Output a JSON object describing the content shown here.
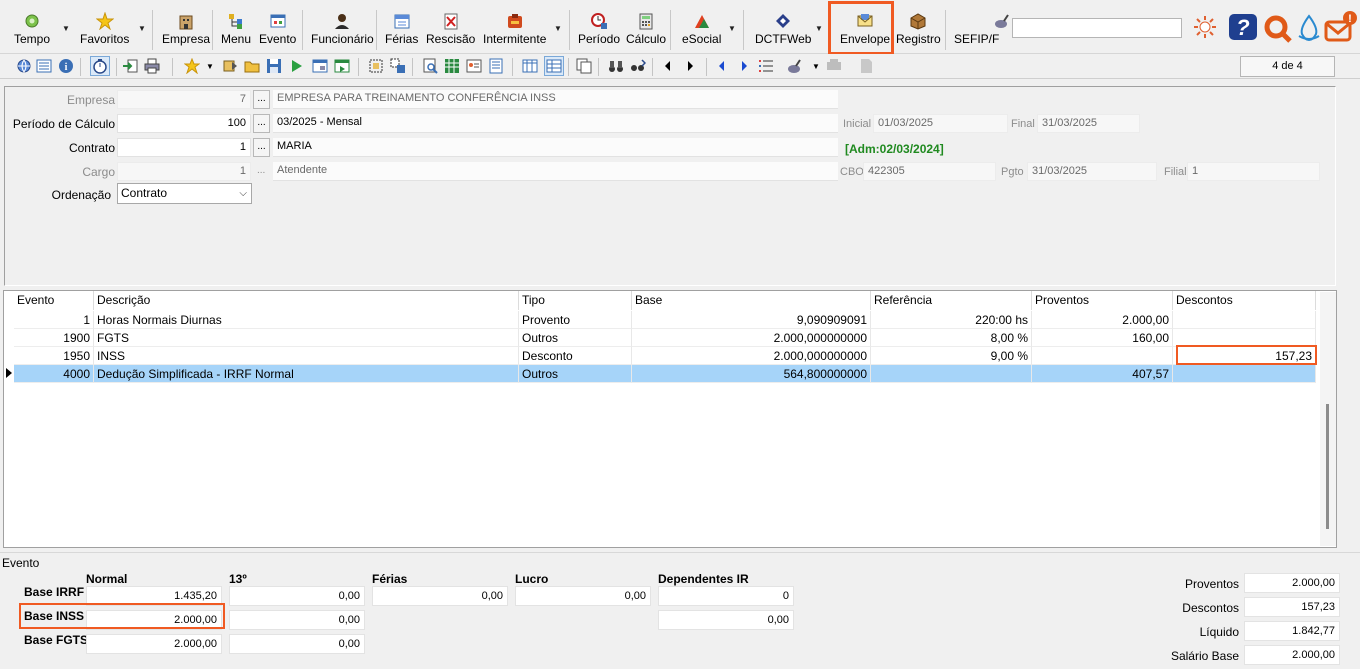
{
  "ribbon": {
    "tempo": "Tempo",
    "favoritos": "Favoritos",
    "empresa": "Empresa",
    "menu": "Menu",
    "evento": "Evento",
    "funcionario": "Funcionário",
    "ferias": "Férias",
    "rescisao": "Rescisão",
    "intermitente": "Intermitente",
    "periodo": "Período",
    "calculo": "Cálculo",
    "esocial": "eSocial",
    "dctfweb": "DCTFWeb",
    "envelope": "Envelope",
    "registro": "Registro",
    "sefip": "SEFIP/F",
    "sefip_value": ""
  },
  "toolbar2": {
    "record_counter": "4 de 4"
  },
  "form": {
    "empresa_label": "Empresa",
    "empresa_code": "7",
    "empresa_name": "EMPRESA PARA TREINAMENTO CONFERÊNCIA INSS",
    "periodo_label": "Período de Cálculo",
    "periodo_code": "100",
    "periodo_name": "03/2025 - Mensal",
    "inicial_label": "Inicial",
    "inicial_value": "01/03/2025",
    "final_label": "Final",
    "final_value": "31/03/2025",
    "contrato_label": "Contrato",
    "contrato_code": "1",
    "contrato_name": "MARIA",
    "admissao": "[Adm:02/03/2024]",
    "cargo_label": "Cargo",
    "cargo_code": "1",
    "cargo_name": "Atendente",
    "cbo_label": "CBO",
    "cbo_value": "422305",
    "pgto_label": "Pgto",
    "pgto_value": "31/03/2025",
    "filial_label": "Filial",
    "filial_value": "1",
    "ordenacao_label": "Ordenação",
    "ordenacao_value": "Contrato",
    "dots": "..."
  },
  "grid": {
    "columns": [
      "Evento",
      "Descrição",
      "Tipo",
      "Base",
      "Referência",
      "Proventos",
      "Descontos"
    ],
    "rows": [
      {
        "evento": "1",
        "descricao": "Horas Normais Diurnas",
        "tipo": "Provento",
        "base": "9,090909091",
        "referencia": "220:00 hs",
        "proventos": "2.000,00",
        "descontos": ""
      },
      {
        "evento": "1900",
        "descricao": "FGTS",
        "tipo": "Outros",
        "base": "2.000,000000000",
        "referencia": "8,00 %",
        "proventos": "160,00",
        "descontos": ""
      },
      {
        "evento": "1950",
        "descricao": "INSS",
        "tipo": "Desconto",
        "base": "2.000,000000000",
        "referencia": "9,00 %",
        "proventos": "",
        "descontos": "157,23"
      },
      {
        "evento": "4000",
        "descricao": "Dedução Simplificada - IRRF Normal",
        "tipo": "Outros",
        "base": "564,800000000",
        "referencia": "",
        "proventos": "407,57",
        "descontos": ""
      }
    ]
  },
  "bottom": {
    "section_title": "Evento",
    "col_normal": "Normal",
    "col_13": "13º",
    "col_ferias": "Férias",
    "col_lucro": "Lucro",
    "col_dependentes": "Dependentes IR",
    "base_irrf_label": "Base IRRF",
    "base_inss_label": "Base INSS",
    "base_fgts_label": "Base FGTS",
    "irrf_normal": "1.435,20",
    "irrf_13": "0,00",
    "irrf_ferias": "0,00",
    "irrf_lucro": "0,00",
    "irrf_dependentes": "0",
    "inss_normal": "2.000,00",
    "inss_13": "0,00",
    "inss_dependentes": "0,00",
    "fgts_normal": "2.000,00",
    "fgts_13": "0,00",
    "proventos_label": "Proventos",
    "proventos_value": "2.000,00",
    "descontos_label": "Descontos",
    "descontos_value": "157,23",
    "liquido_label": "Líquido",
    "liquido_value": "1.842,77",
    "salario_base_label": "Salário Base",
    "salario_base_value": "2.000,00"
  },
  "colors": {
    "highlight": "#f05a22",
    "selected_row": "#a6d4f9",
    "admission_green": "#208a20"
  }
}
